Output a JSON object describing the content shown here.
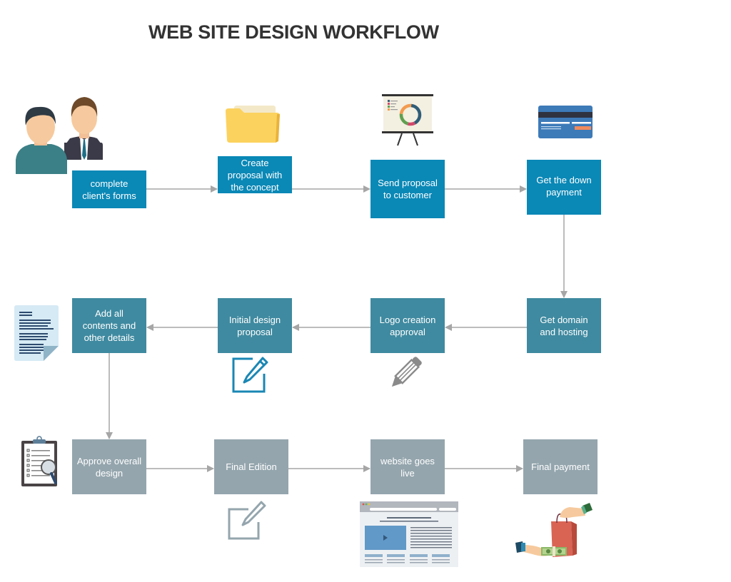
{
  "title": "WEB SITE DESIGN WORKFLOW",
  "colors": {
    "row1": "#0a88b6",
    "row2": "#3f8aa0",
    "row3": "#94a5ad",
    "connector": "#a6a6a6",
    "title": "#333333"
  },
  "steps": [
    {
      "id": "complete-forms",
      "label": "complete client's forms",
      "icon": "people-icon"
    },
    {
      "id": "create-proposal",
      "label": "Create proposal with the concept",
      "icon": "folder-icon"
    },
    {
      "id": "send-proposal",
      "label": "Send proposal to customer",
      "icon": "presentation-board-icon"
    },
    {
      "id": "down-payment",
      "label": "Get the down payment",
      "icon": "credit-card-icon"
    },
    {
      "id": "domain-hosting",
      "label": "Get domain and hosting",
      "icon": ""
    },
    {
      "id": "logo-approval",
      "label": "Logo creation approval",
      "icon": "pencil-icon"
    },
    {
      "id": "initial-design",
      "label": "Initial design proposal",
      "icon": "edit-square-icon"
    },
    {
      "id": "add-contents",
      "label": "Add all contents and other details",
      "icon": "document-icon"
    },
    {
      "id": "approve-design",
      "label": "Approve overall design",
      "icon": "clipboard-search-icon"
    },
    {
      "id": "final-edition",
      "label": "Final Edition",
      "icon": "edit-square-icon"
    },
    {
      "id": "website-live",
      "label": "website goes live",
      "icon": "browser-window-icon"
    },
    {
      "id": "final-payment",
      "label": "Final payment",
      "icon": "payment-exchange-icon"
    }
  ],
  "flow": [
    [
      "complete-forms",
      "create-proposal"
    ],
    [
      "create-proposal",
      "send-proposal"
    ],
    [
      "send-proposal",
      "down-payment"
    ],
    [
      "down-payment",
      "domain-hosting"
    ],
    [
      "domain-hosting",
      "logo-approval"
    ],
    [
      "logo-approval",
      "initial-design"
    ],
    [
      "initial-design",
      "add-contents"
    ],
    [
      "add-contents",
      "approve-design"
    ],
    [
      "approve-design",
      "final-edition"
    ],
    [
      "final-edition",
      "website-live"
    ],
    [
      "website-live",
      "final-payment"
    ]
  ]
}
